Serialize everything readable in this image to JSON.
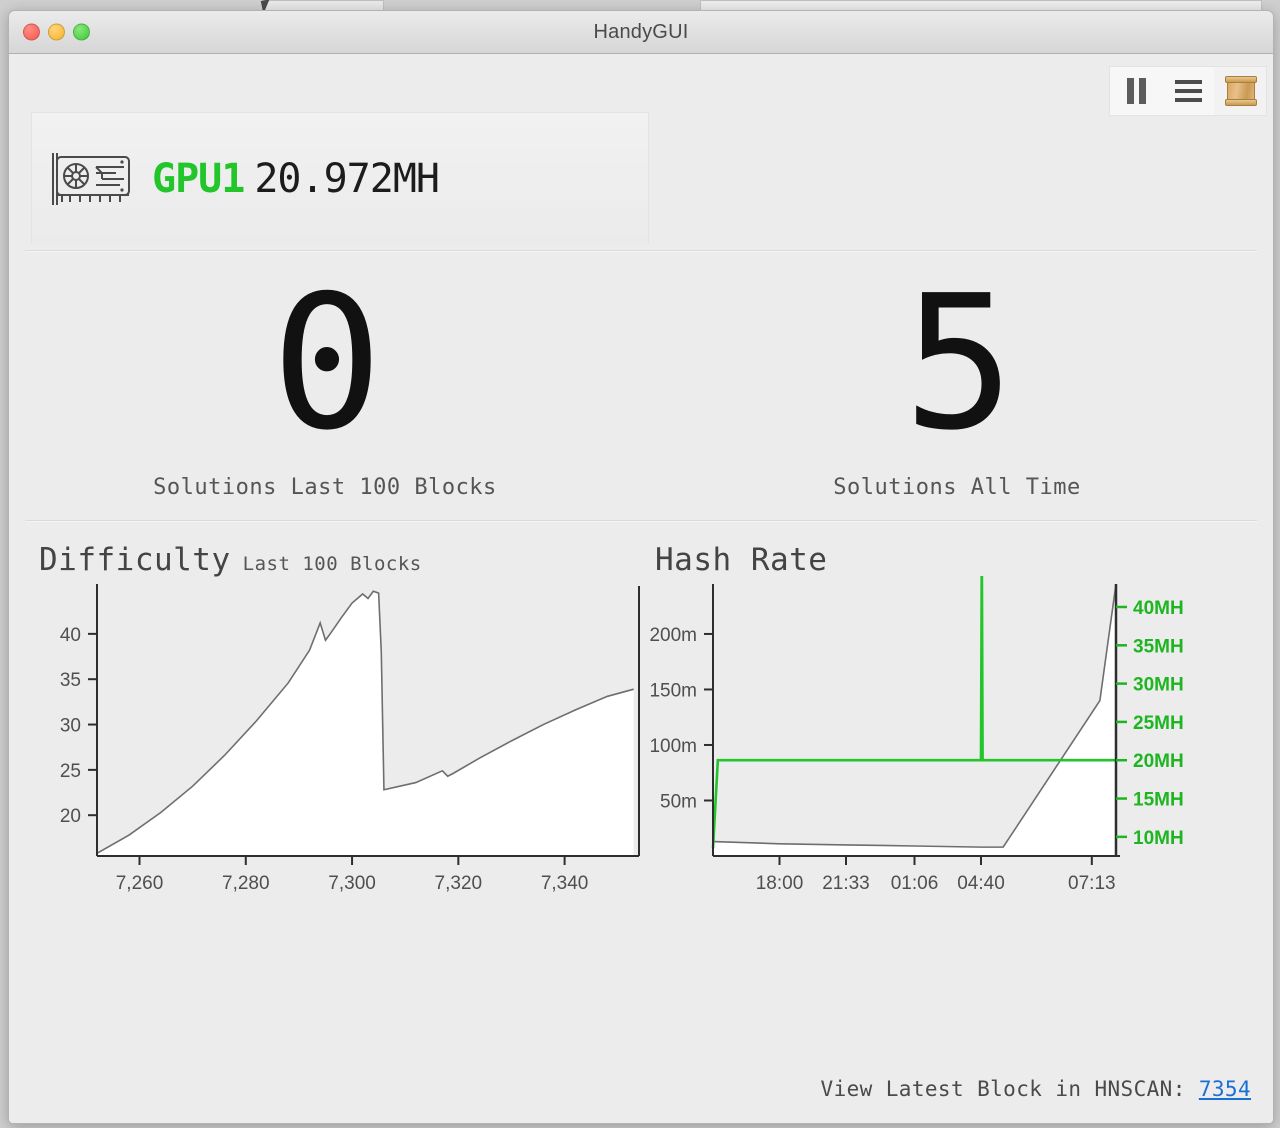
{
  "window": {
    "title": "HandyGUI",
    "traffic_lights": [
      "close",
      "minimize",
      "zoom"
    ]
  },
  "toolbar": {
    "buttons": [
      {
        "name": "pause-button",
        "icon": "pause-icon",
        "label": "Pause"
      },
      {
        "name": "menu-button",
        "icon": "hamburger-menu-icon",
        "label": "Menu"
      },
      {
        "name": "logs-button",
        "icon": "scroll-parchment-icon",
        "label": "Logs"
      }
    ]
  },
  "gpu": {
    "icon": "graphics-card-icon",
    "label": "GPU1",
    "hashrate": "20.972MH",
    "label_color": "#22c52a"
  },
  "stats": [
    {
      "value": "0",
      "label": "Solutions Last 100 Blocks"
    },
    {
      "value": "5",
      "label": "Solutions All Time"
    }
  ],
  "footer": {
    "text": "View Latest Block in HNSCAN:",
    "link_label": "7354",
    "link_color": "#1a6fd4"
  },
  "chart_data": [
    {
      "type": "area",
      "title": "Difficulty",
      "subtitle": "Last 100 Blocks",
      "xlabel": "",
      "ylabel": "",
      "grid": false,
      "legend": "none",
      "line_color": "#6e6e6e",
      "fill_color": "#ffffff",
      "xlim": [
        7252,
        7354
      ],
      "ylim": [
        15.5,
        45.5
      ],
      "xticks": [
        7260,
        7280,
        7300,
        7320,
        7340
      ],
      "xtick_labels": [
        "7,260",
        "7,280",
        "7,300",
        "7,320",
        "7,340"
      ],
      "yticks": [
        20,
        25,
        30,
        35,
        40
      ],
      "ytick_labels": [
        "20",
        "25",
        "30",
        "35",
        "40"
      ],
      "x": [
        7252,
        7258,
        7264,
        7270,
        7276,
        7282,
        7288,
        7292,
        7294,
        7295,
        7296,
        7298,
        7300,
        7302,
        7303,
        7304,
        7305,
        7305.5,
        7306,
        7312,
        7317,
        7318,
        7319,
        7324,
        7330,
        7336,
        7342,
        7348,
        7353
      ],
      "y": [
        15.8,
        17.8,
        20.3,
        23.2,
        26.6,
        30.4,
        34.6,
        38.2,
        41.2,
        39.3,
        40.1,
        41.8,
        43.4,
        44.4,
        43.9,
        44.7,
        44.5,
        38.0,
        22.8,
        23.6,
        24.9,
        24.3,
        24.6,
        26.3,
        28.2,
        30.0,
        31.6,
        33.1,
        33.9
      ]
    },
    {
      "type": "line",
      "title": "Hash Rate",
      "subtitle": "",
      "grid": false,
      "legend": "none",
      "series": [
        {
          "name": "share-rate",
          "axis": "left",
          "color": "#6e6e6e",
          "fill": "#ffffff",
          "x": [
            "16:00",
            "18:00",
            "21:33",
            "01:06",
            "04:40",
            "05:40",
            "07:13",
            "07:40"
          ],
          "y": [
            13,
            11,
            10,
            9,
            8,
            8,
            140,
            245
          ]
        },
        {
          "name": "hashrate",
          "axis": "right",
          "color": "#22c52a",
          "x": [
            "16:00",
            "16:05",
            "04:40",
            "04:41",
            "04:42",
            "07:40"
          ],
          "y": [
            8.5,
            20.0,
            20.0,
            48.0,
            20.0,
            20.0
          ]
        }
      ],
      "xticks": [
        "18:00",
        "21:33",
        "01:06",
        "04:40",
        "07:13"
      ],
      "left_axis": {
        "ticks": [
          50,
          100,
          150,
          200
        ],
        "tick_labels": [
          "50m",
          "100m",
          "150m",
          "200m"
        ],
        "ylim": [
          0,
          245
        ],
        "color": "#4f4f4f"
      },
      "right_axis": {
        "ticks": [
          10,
          15,
          20,
          25,
          30,
          35,
          40
        ],
        "tick_labels": [
          "10MH",
          "15MH",
          "20MH",
          "25MH",
          "30MH",
          "35MH",
          "40MH"
        ],
        "ylim": [
          7.5,
          43
        ],
        "color": "#1fb522"
      }
    }
  ]
}
